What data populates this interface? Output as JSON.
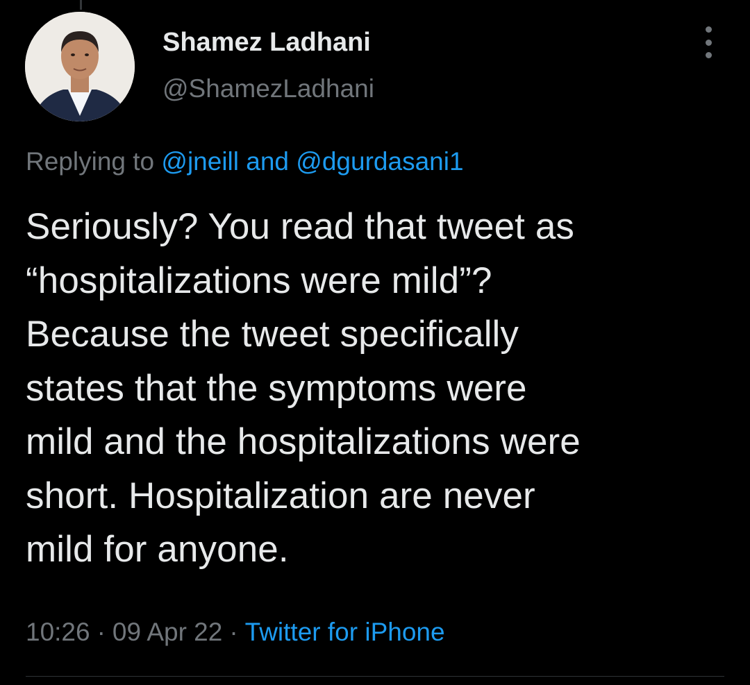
{
  "author": {
    "display_name": "Shamez Ladhani",
    "handle": "@ShamezLadhani",
    "avatar_icon": "profile-photo"
  },
  "reply": {
    "prefix": "Replying to",
    "mention_1": "@jneill",
    "conjunction": "and",
    "mention_2": "@dgurdasani1"
  },
  "tweet": {
    "lines": [
      "Seriously? You read that tweet as",
      "“hospitalizations were mild”?",
      "Because the tweet specifically",
      "states that the symptoms were",
      "mild and the hospitalizations were",
      "short. Hospitalization are never",
      "mild for anyone."
    ]
  },
  "meta": {
    "time": "10:26",
    "separator": "·",
    "date": "09 Apr 22",
    "source": "Twitter for iPhone"
  },
  "colors": {
    "background": "#000000",
    "text": "#e7e9ea",
    "muted": "#71767b",
    "link": "#1d9bf0"
  },
  "icons": {
    "more": "more-vertical-icon"
  }
}
